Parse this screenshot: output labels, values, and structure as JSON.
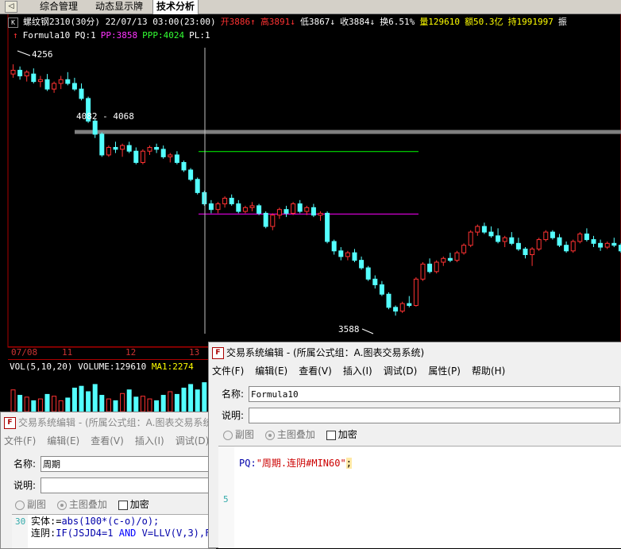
{
  "tabs": {
    "arrow": "◁",
    "items": [
      "综合管理",
      "动态显示牌",
      "技术分析"
    ],
    "active": 2
  },
  "info": {
    "k_icon": "K",
    "symbol": "螺纹钢2310(30分) 22/07/13 03:00(23:00)",
    "open": "开3886↑",
    "high": "高3891↓",
    "low": "低3867↓",
    "close": "收3884↓",
    "turnover": "换6.51%",
    "volume": "量129610",
    "amount": "额50.3亿",
    "oi": "持1991997",
    "amp": "振"
  },
  "formula_line": {
    "icon": "↑",
    "name": "Formula10",
    "pq": "PQ:1",
    "pp": "PP:3858",
    "ppp": "PPP:4024",
    "pl": "PL:1"
  },
  "chart_data": {
    "type": "candlestick",
    "ylim": [
      3540,
      4300
    ],
    "annotations": {
      "high_label": "4256",
      "low_label": "3588",
      "band_label": "4082 - 4068"
    },
    "hlines": {
      "band": 4075,
      "pp": 3858,
      "ppp": 4024
    },
    "dates": [
      "07/08",
      "11",
      "12",
      "13"
    ],
    "candles": [
      [
        4230,
        4256,
        4220,
        4240
      ],
      [
        4240,
        4250,
        4215,
        4225
      ],
      [
        4225,
        4240,
        4210,
        4235
      ],
      [
        4230,
        4245,
        4205,
        4210
      ],
      [
        4210,
        4225,
        4195,
        4215
      ],
      [
        4215,
        4230,
        4185,
        4190
      ],
      [
        4190,
        4210,
        4180,
        4205
      ],
      [
        4205,
        4225,
        4190,
        4215
      ],
      [
        4215,
        4235,
        4200,
        4205
      ],
      [
        4205,
        4220,
        4185,
        4190
      ],
      [
        4190,
        4205,
        4160,
        4165
      ],
      [
        4165,
        4170,
        4100,
        4105
      ],
      [
        4105,
        4110,
        4060,
        4070
      ],
      [
        4070,
        4075,
        4010,
        4015
      ],
      [
        4015,
        4040,
        4010,
        4035
      ],
      [
        4035,
        4050,
        4020,
        4030
      ],
      [
        4030,
        4045,
        4010,
        4040
      ],
      [
        4040,
        4050,
        4020,
        4025
      ],
      [
        4025,
        4035,
        3990,
        3995
      ],
      [
        3995,
        4030,
        3990,
        4025
      ],
      [
        4025,
        4040,
        4015,
        4035
      ],
      [
        4035,
        4045,
        4020,
        4030
      ],
      [
        4030,
        4040,
        4005,
        4010
      ],
      [
        4010,
        4020,
        3995,
        4015
      ],
      [
        4015,
        4025,
        3990,
        3995
      ],
      [
        3995,
        4000,
        3970,
        3975
      ],
      [
        3975,
        3980,
        3945,
        3950
      ],
      [
        3950,
        3955,
        3910,
        3915
      ],
      [
        3915,
        3920,
        3880,
        3885
      ],
      [
        3885,
        3895,
        3860,
        3870
      ],
      [
        3870,
        3890,
        3860,
        3885
      ],
      [
        3885,
        3905,
        3875,
        3900
      ],
      [
        3900,
        3910,
        3880,
        3885
      ],
      [
        3885,
        3895,
        3860,
        3865
      ],
      [
        3865,
        3880,
        3860,
        3875
      ],
      [
        3875,
        3890,
        3865,
        3880
      ],
      [
        3880,
        3885,
        3855,
        3860
      ],
      [
        3860,
        3865,
        3820,
        3825
      ],
      [
        3825,
        3860,
        3815,
        3855
      ],
      [
        3855,
        3875,
        3845,
        3870
      ],
      [
        3870,
        3880,
        3850,
        3860
      ],
      [
        3860,
        3890,
        3855,
        3885
      ],
      [
        3885,
        3895,
        3860,
        3865
      ],
      [
        3865,
        3880,
        3855,
        3875
      ],
      [
        3875,
        3885,
        3850,
        3855
      ],
      [
        3855,
        3865,
        3840,
        3860
      ],
      [
        3860,
        3865,
        3780,
        3785
      ],
      [
        3785,
        3790,
        3750,
        3760
      ],
      [
        3760,
        3770,
        3735,
        3745
      ],
      [
        3745,
        3760,
        3735,
        3755
      ],
      [
        3755,
        3765,
        3730,
        3735
      ],
      [
        3735,
        3745,
        3710,
        3715
      ],
      [
        3715,
        3720,
        3680,
        3685
      ],
      [
        3685,
        3695,
        3660,
        3670
      ],
      [
        3670,
        3680,
        3640,
        3645
      ],
      [
        3645,
        3650,
        3605,
        3610
      ],
      [
        3610,
        3615,
        3588,
        3600
      ],
      [
        3600,
        3625,
        3595,
        3620
      ],
      [
        3620,
        3640,
        3610,
        3615
      ],
      [
        3615,
        3690,
        3612,
        3685
      ],
      [
        3685,
        3730,
        3680,
        3725
      ],
      [
        3725,
        3740,
        3700,
        3705
      ],
      [
        3705,
        3735,
        3700,
        3730
      ],
      [
        3730,
        3745,
        3720,
        3740
      ],
      [
        3740,
        3755,
        3730,
        3735
      ],
      [
        3735,
        3760,
        3730,
        3755
      ],
      [
        3755,
        3780,
        3750,
        3775
      ],
      [
        3775,
        3815,
        3770,
        3810
      ],
      [
        3810,
        3830,
        3800,
        3825
      ],
      [
        3825,
        3835,
        3805,
        3810
      ],
      [
        3810,
        3825,
        3795,
        3800
      ],
      [
        3800,
        3820,
        3780,
        3785
      ],
      [
        3785,
        3800,
        3770,
        3795
      ],
      [
        3795,
        3810,
        3775,
        3780
      ],
      [
        3780,
        3795,
        3760,
        3765
      ],
      [
        3765,
        3770,
        3740,
        3750
      ],
      [
        3750,
        3770,
        3720,
        3765
      ],
      [
        3765,
        3795,
        3760,
        3790
      ],
      [
        3790,
        3815,
        3785,
        3810
      ],
      [
        3810,
        3815,
        3790,
        3795
      ],
      [
        3795,
        3805,
        3770,
        3775
      ],
      [
        3775,
        3785,
        3755,
        3760
      ],
      [
        3760,
        3790,
        3755,
        3785
      ],
      [
        3785,
        3810,
        3780,
        3805
      ],
      [
        3805,
        3820,
        3785,
        3790
      ],
      [
        3790,
        3800,
        3770,
        3780
      ],
      [
        3780,
        3790,
        3760,
        3770
      ],
      [
        3770,
        3785,
        3765,
        3780
      ],
      [
        3780,
        3795,
        3770,
        3775
      ],
      [
        3775,
        3780,
        3755,
        3760
      ],
      [
        3760,
        3775,
        3755,
        3770
      ],
      [
        3770,
        3800,
        3765,
        3795
      ]
    ],
    "volume": [
      120,
      90,
      80,
      60,
      70,
      95,
      85,
      60,
      75,
      130,
      140,
      110,
      150,
      90,
      70,
      60,
      100,
      120,
      80,
      85,
      70,
      60,
      90,
      110,
      95,
      130,
      150,
      120,
      160,
      100,
      80,
      90,
      70,
      60,
      85,
      95,
      140,
      110,
      60,
      70,
      90,
      80,
      75,
      65,
      60,
      150,
      170,
      140,
      120,
      100,
      130,
      160,
      180,
      150,
      140,
      190,
      120,
      210,
      160,
      140,
      120,
      100,
      110,
      90,
      80,
      75,
      90,
      130,
      110,
      95,
      85,
      100,
      90,
      80,
      95,
      130,
      120,
      90,
      80,
      70,
      85,
      100,
      90,
      80,
      70,
      75,
      65,
      60,
      70,
      80
    ]
  },
  "volume_line": {
    "label": "VOL(5,10,20) VOLUME:129610",
    "ma1": "MA1:2274"
  },
  "dialog_back": {
    "title": "交易系统编辑 - (所属公式组：A.图表交易系统",
    "menu": [
      "文件(F)",
      "编辑(E)",
      "查看(V)",
      "插入(I)",
      "调试(D)"
    ],
    "name_label": "名称:",
    "name_value": "周期",
    "desc_label": "说明:",
    "opt1": "副图",
    "opt2": "主图叠加",
    "opt3": "加密",
    "line_no": "30",
    "code1_a": "实体:=",
    "code1_b": "abs",
    "code1_c": "(100*(c-o)/o);",
    "code2_a": "连阴:",
    "code2_b": "IF",
    "code2_c": "(JSJD4=1 ",
    "code2_d": "AND",
    "code2_e": " V=",
    "code2_f": "LLV",
    "code2_g": "(V,3),F"
  },
  "dialog_front": {
    "title": "交易系统编辑 - (所属公式组：A.图表交易系统)",
    "menu": [
      "文件(F)",
      "编辑(E)",
      "查看(V)",
      "插入(I)",
      "调试(D)",
      "属性(P)",
      "帮助(H)"
    ],
    "name_label": "名称:",
    "name_value": "Formula10",
    "desc_label": "说明:",
    "opt1": "副图",
    "opt2": "主图叠加",
    "opt3": "加密",
    "line_no": "5",
    "code_a": "PQ:",
    "code_b": "\"周期.连阴#MIN60\"",
    "code_c": ";"
  },
  "colors": {
    "up": "#ff3232",
    "down": "#54ffff",
    "band": "#808080",
    "pp": "#ff00ff",
    "ppp": "#00ff00",
    "cursor": "#c0c0c0"
  }
}
